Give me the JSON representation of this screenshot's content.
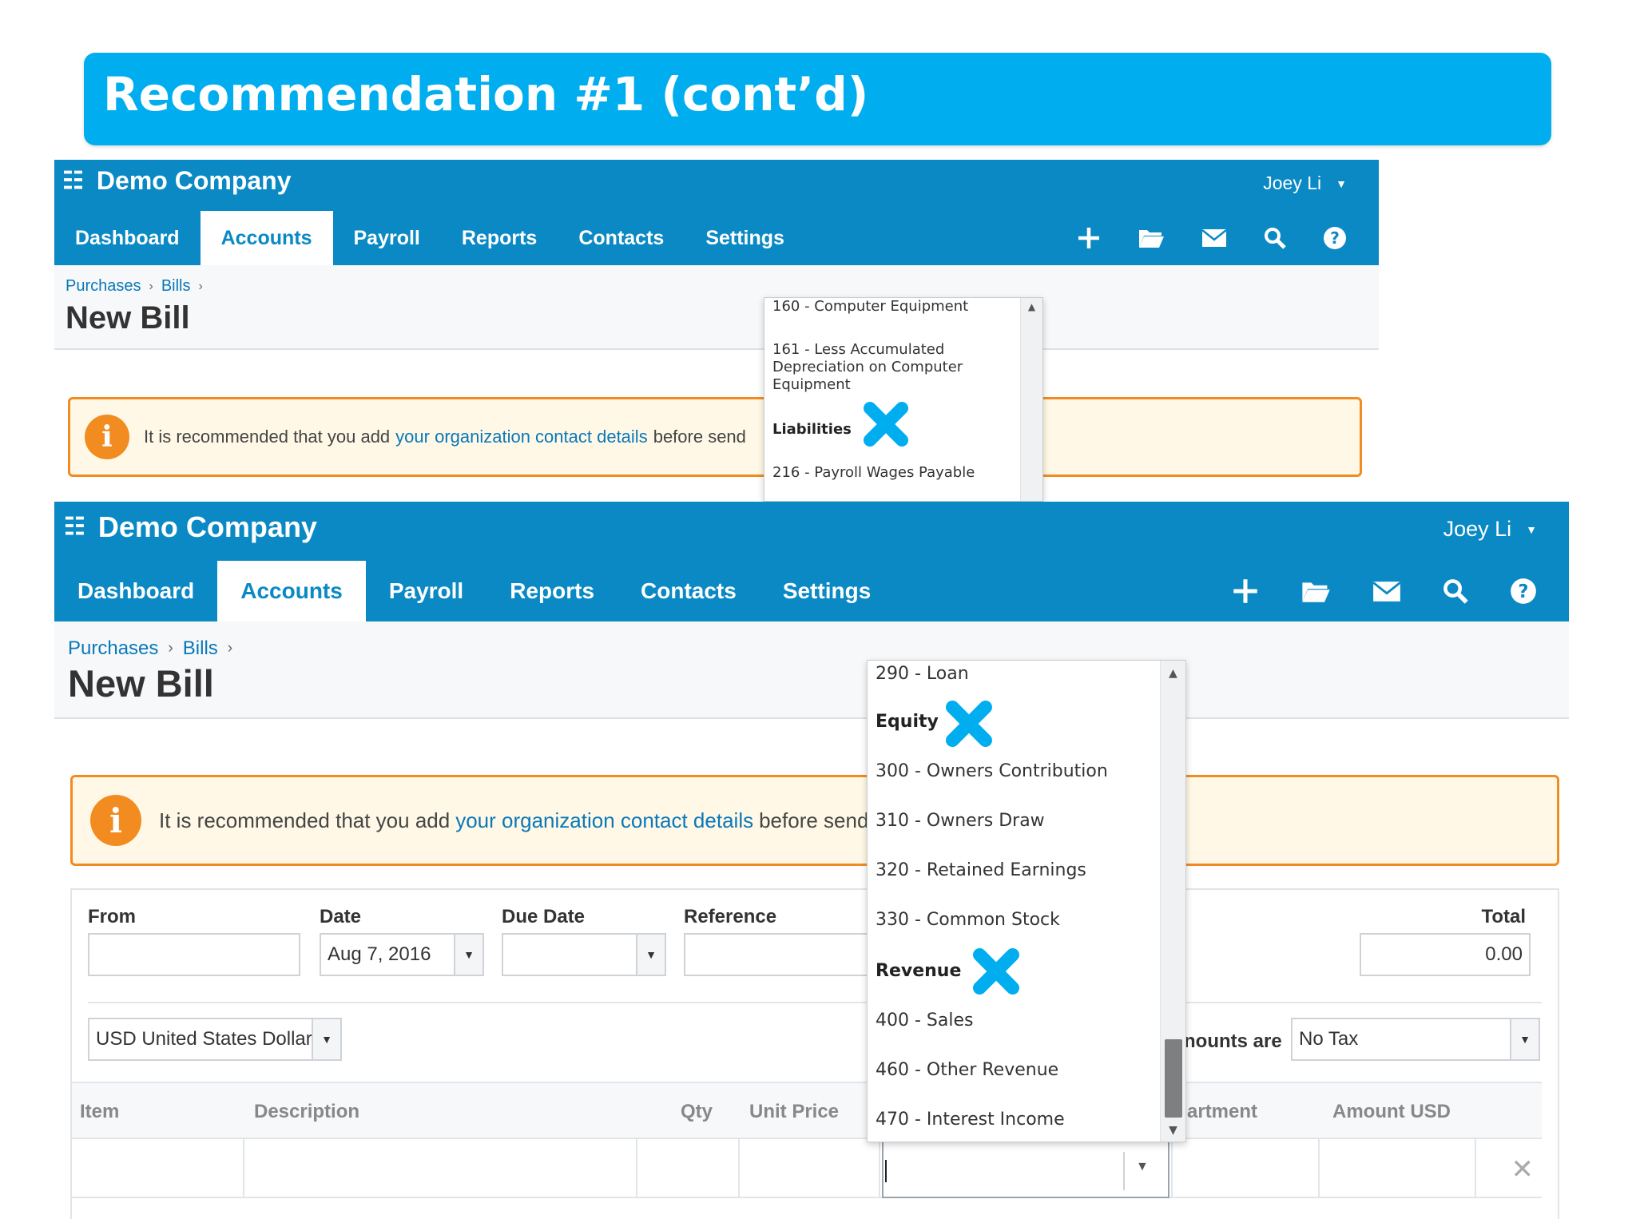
{
  "slide": {
    "title": "Recommendation #1 (cont’d)"
  },
  "app": {
    "company": "Demo Company",
    "user": "Joey Li",
    "tabs": [
      "Dashboard",
      "Accounts",
      "Payroll",
      "Reports",
      "Contacts",
      "Settings"
    ],
    "active_tab": "Accounts",
    "icons": [
      "plus-icon",
      "folder-icon",
      "mail-icon",
      "search-icon",
      "help-icon"
    ],
    "breadcrumb": [
      "Purchases",
      "Bills"
    ],
    "page_title": "New Bill",
    "alert": {
      "prefix": "It is recommended that you add",
      "link": "your organization contact details",
      "suffix": "before send"
    }
  },
  "colors": {
    "brand": "#0a89c4",
    "slide_banner": "#00aeef",
    "alert_border": "#f28c20",
    "x_mark": "#00aeef"
  },
  "dropdown1": {
    "items": [
      {
        "text": "160 - Computer Equipment",
        "heading": false
      },
      {
        "text": "161 - Less Accumulated Depreciation on Computer Equipment",
        "heading": false
      },
      {
        "text": "Liabilities",
        "heading": true,
        "crossed": true
      },
      {
        "text": "216 - Payroll Wages Payable",
        "heading": false
      }
    ]
  },
  "dropdown2": {
    "items": [
      {
        "text": "290 - Loan",
        "heading": false
      },
      {
        "text": "Equity",
        "heading": true,
        "crossed": true
      },
      {
        "text": "300 - Owners Contribution",
        "heading": false
      },
      {
        "text": "310 - Owners Draw",
        "heading": false
      },
      {
        "text": "320 - Retained Earnings",
        "heading": false
      },
      {
        "text": "330 - Common Stock",
        "heading": false
      },
      {
        "text": "Revenue",
        "heading": true,
        "crossed": true
      },
      {
        "text": "400 - Sales",
        "heading": false
      },
      {
        "text": "460 - Other Revenue",
        "heading": false
      },
      {
        "text": "470 - Interest Income",
        "heading": false
      }
    ]
  },
  "form": {
    "labels": {
      "from": "From",
      "date": "Date",
      "due_date": "Due Date",
      "reference": "Reference",
      "total": "Total",
      "amounts_are": "nounts are"
    },
    "values": {
      "from": "",
      "date": "Aug 7, 2016",
      "due_date": "",
      "reference": "",
      "total": "0.00",
      "currency": "USD United States Dollar",
      "tax": "No Tax"
    },
    "columns": {
      "item": "Item",
      "description": "Description",
      "qty": "Qty",
      "unit_price": "Unit Price",
      "department": "artment",
      "amount": "Amount USD"
    }
  }
}
